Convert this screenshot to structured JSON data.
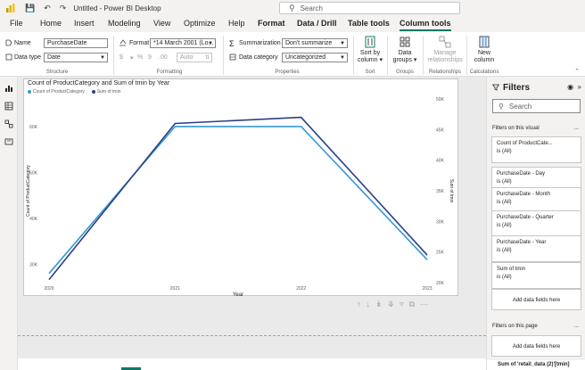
{
  "titlebar": {
    "app_title": "Untitled - Power BI Desktop",
    "search_placeholder": "Search"
  },
  "menu": {
    "tabs": [
      {
        "label": "File"
      },
      {
        "label": "Home"
      },
      {
        "label": "Insert"
      },
      {
        "label": "Modeling"
      },
      {
        "label": "View"
      },
      {
        "label": "Optimize"
      },
      {
        "label": "Help"
      },
      {
        "label": "Format"
      },
      {
        "label": "Data / Drill"
      },
      {
        "label": "Table tools"
      },
      {
        "label": "Column tools"
      }
    ]
  },
  "ribbon": {
    "structure": {
      "name_label": "Name",
      "name_value": "PurchaseDate",
      "datatype_label": "Data type",
      "datatype_value": "Date",
      "group": "Structure"
    },
    "formatting": {
      "format_label": "Format",
      "format_value": "*14 March 2001 (Lo...",
      "currency": "$",
      "percent": "%",
      "comma": "9",
      "decimals_label": ".00",
      "auto_value": "Auto",
      "group": "Formatting"
    },
    "properties": {
      "summarization_label": "Summarization",
      "summarization_value": "Don't summarize",
      "category_label": "Data category",
      "category_value": "Uncategorized",
      "group": "Properties"
    },
    "sort": {
      "button_line1": "Sort by",
      "button_line2": "column",
      "group": "Sort"
    },
    "groups": {
      "button_line1": "Data",
      "button_line2": "groups",
      "group": "Groups"
    },
    "relationships": {
      "button_line1": "Manage",
      "button_line2": "relationships",
      "group": "Relationships"
    },
    "calculations": {
      "button_line1": "New",
      "button_line2": "column",
      "group": "Calculations"
    }
  },
  "visual": {
    "toolbar_icons": [
      "pin-up-icon",
      "drill-down-icon",
      "expand-down-icon",
      "expand-all-icon",
      "filter-icon",
      "focus-mode-icon",
      "more-options-icon"
    ]
  },
  "filters": {
    "title": "Filters",
    "search_placeholder": "Search",
    "on_visual_label": "Filters on this visual",
    "more": "...",
    "cards": [
      {
        "name": "Count of ProductCate...",
        "state": "is (All)"
      },
      {
        "name": "PurchaseDate - Day",
        "state": "is (All)"
      },
      {
        "name": "PurchaseDate - Month",
        "state": "is (All)"
      },
      {
        "name": "PurchaseDate - Quarter",
        "state": "is (All)"
      },
      {
        "name": "PurchaseDate - Year",
        "state": "is (All)"
      },
      {
        "name": "Sum of tmin",
        "state": "is (All)"
      }
    ],
    "add_fields": "Add data fields here",
    "on_page_label": "Filters on this page",
    "add_fields_page": "Add data fields here",
    "bottom_field": "Sum of 'retail_data (2)'[tmin]"
  },
  "colors": {
    "accent": "#117865",
    "series1": "#3599d4",
    "series2": "#2c3f87"
  },
  "chart_data": {
    "type": "line",
    "title": "Count of ProductCategory and Sum of tmin by Year",
    "xlabel": "Year",
    "ylabel": "Count of ProductCategory",
    "ylabel_right": "Sum of tmin",
    "x": [
      "2020",
      "2021",
      "2022",
      "2023"
    ],
    "y_ticks_left": [
      "30K",
      "40K",
      "50K",
      "60K"
    ],
    "y_ticks_right": [
      "20K",
      "25K",
      "30K",
      "35K",
      "40K",
      "45K",
      "50K"
    ],
    "ylim_left": [
      26000,
      66000
    ],
    "ylim_right": [
      20000,
      50000
    ],
    "series": [
      {
        "name": "Count of ProductCategory",
        "axis": "left",
        "values": [
          28000,
          60000,
          60000,
          31000
        ]
      },
      {
        "name": "Sum of tmin",
        "axis": "right",
        "values": [
          20500,
          46000,
          47000,
          24500
        ]
      }
    ],
    "legend": "top-left",
    "grid": false
  }
}
